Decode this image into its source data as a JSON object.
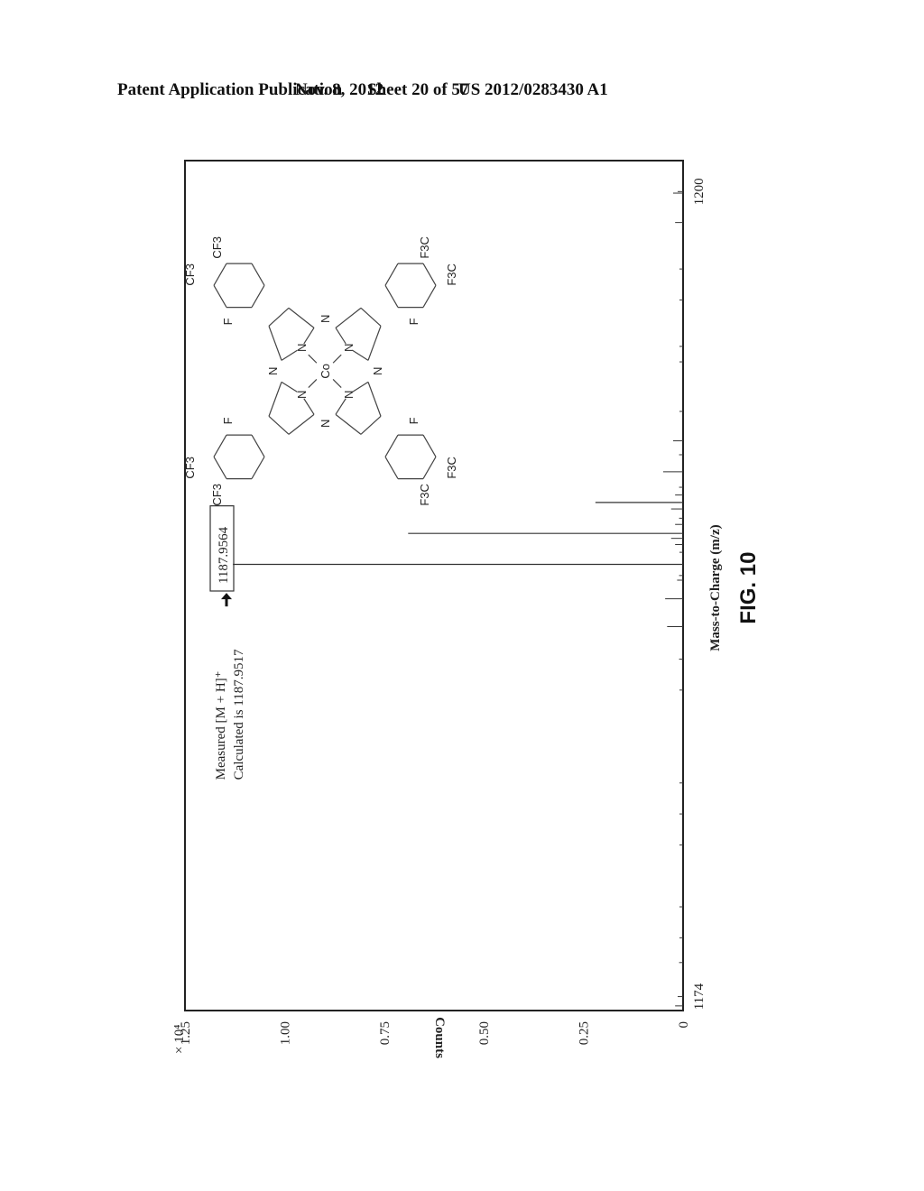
{
  "header": {
    "left": "Patent Application Publication",
    "date": "Nov. 8, 2012",
    "sheet": "Sheet 20 of 57",
    "number": "US 2012/0283430 A1"
  },
  "figure_label": "FIG. 10",
  "chart_data": {
    "type": "bar",
    "subtype": "mass-spectrum-stick",
    "orientation": "figure rotated 90° counter-clockwise on page",
    "title": "",
    "xlabel": "Mass-to-Charge (m/z)",
    "ylabel": "Counts",
    "y_multiplier": "× 10⁴",
    "xlim": [
      1173.5,
      1201.0
    ],
    "ylim": [
      0,
      1.25
    ],
    "x_ticks": [
      1174,
      1200
    ],
    "x_tick_labels": [
      "1174",
      "1200"
    ],
    "y_ticks": [
      0,
      0.25,
      0.5,
      0.75,
      1.0,
      1.25
    ],
    "y_tick_labels": [
      "0",
      "0.25",
      "0.50",
      "0.75",
      "1.00",
      "1.25"
    ],
    "grid": false,
    "legend": "none",
    "peaks": [
      {
        "mz": 1173.7,
        "counts": 0.02
      },
      {
        "mz": 1175.1,
        "counts": 0.01
      },
      {
        "mz": 1175.9,
        "counts": 0.005
      },
      {
        "mz": 1176.9,
        "counts": 0.005
      },
      {
        "mz": 1178.9,
        "counts": 0.008
      },
      {
        "mz": 1179.9,
        "counts": 0.005
      },
      {
        "mz": 1180.9,
        "counts": 0.004
      },
      {
        "mz": 1183.9,
        "counts": 0.006
      },
      {
        "mz": 1184.9,
        "counts": 0.01
      },
      {
        "mz": 1185.95,
        "counts": 0.04
      },
      {
        "mz": 1186.85,
        "counts": 0.045
      },
      {
        "mz": 1187.45,
        "counts": 0.015
      },
      {
        "mz": 1187.6,
        "counts": 0.01
      },
      {
        "mz": 1187.96,
        "counts": 1.13
      },
      {
        "mz": 1188.35,
        "counts": 0.008
      },
      {
        "mz": 1188.6,
        "counts": 0.02
      },
      {
        "mz": 1188.8,
        "counts": 0.03
      },
      {
        "mz": 1188.96,
        "counts": 0.69
      },
      {
        "mz": 1189.25,
        "counts": 0.02
      },
      {
        "mz": 1189.45,
        "counts": 0.01
      },
      {
        "mz": 1189.75,
        "counts": 0.03
      },
      {
        "mz": 1189.96,
        "counts": 0.22
      },
      {
        "mz": 1190.2,
        "counts": 0.02
      },
      {
        "mz": 1190.45,
        "counts": 0.01
      },
      {
        "mz": 1190.95,
        "counts": 0.05
      },
      {
        "mz": 1191.5,
        "counts": 0.01
      },
      {
        "mz": 1191.95,
        "counts": 0.025
      },
      {
        "mz": 1192.9,
        "counts": 0.008
      },
      {
        "mz": 1194.5,
        "counts": 0.005
      },
      {
        "mz": 1195.0,
        "counts": 0.006
      },
      {
        "mz": 1196.5,
        "counts": 0.006
      },
      {
        "mz": 1197.5,
        "counts": 0.005
      },
      {
        "mz": 1199.0,
        "counts": 0.02
      },
      {
        "mz": 1199.95,
        "counts": 0.025
      }
    ],
    "annotations": [
      {
        "text": "Measured [M + H]⁺",
        "role": "label-line-1"
      },
      {
        "text": "Calculated is 1187.9517",
        "role": "label-line-2"
      },
      {
        "text": "1187.9564",
        "role": "boxed-peak-label",
        "mz": 1187.96
      }
    ]
  },
  "molecule": {
    "description": "Cobalt phthalocyanine with F and CF3 substituents",
    "metal": "Co",
    "atom_labels": {
      "nitrogen": "N",
      "fluorine": "F",
      "cf3": "CF3",
      "f3c": "F3C"
    }
  }
}
